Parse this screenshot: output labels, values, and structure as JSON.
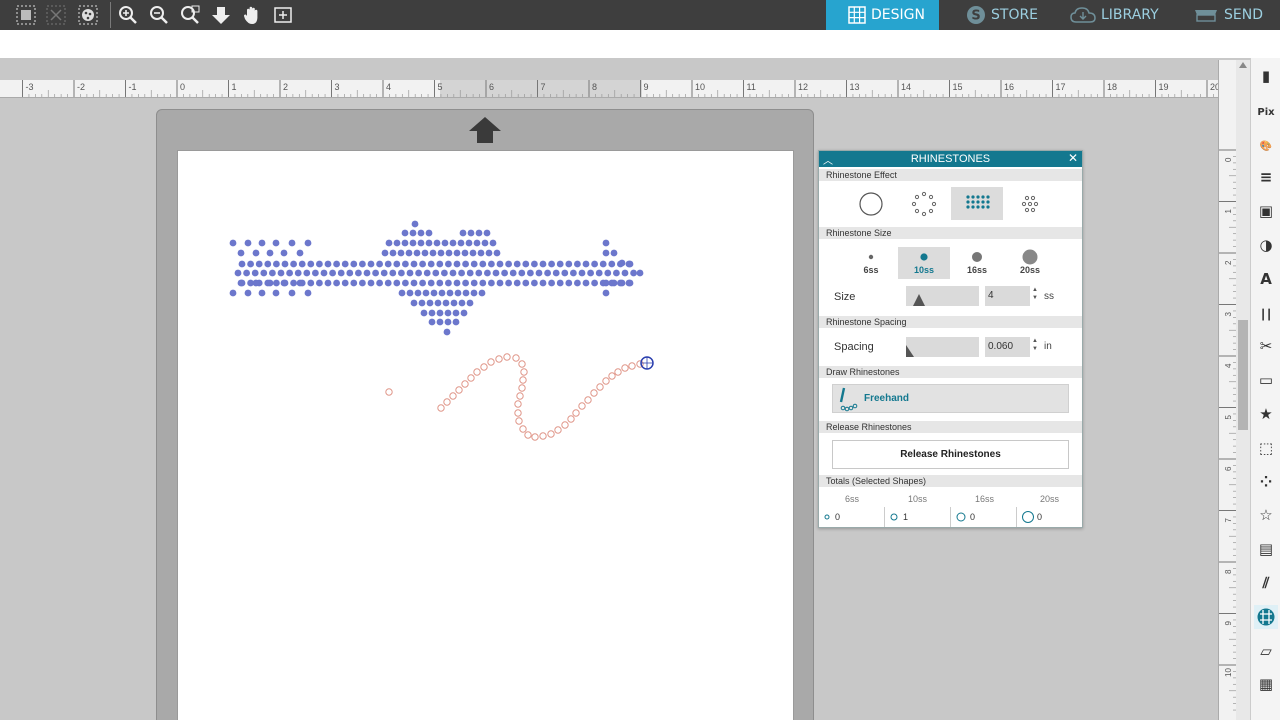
{
  "nav": {
    "tabs": [
      {
        "label": "DESIGN",
        "icon": "grid-icon",
        "active": true
      },
      {
        "label": "STORE",
        "icon": "store-s-icon",
        "active": false
      },
      {
        "label": "LIBRARY",
        "icon": "cloud-library-icon",
        "active": false
      },
      {
        "label": "SEND",
        "icon": "cutter-send-icon",
        "active": false
      }
    ]
  },
  "toolbar": {
    "icons": [
      "group-select-icon",
      "ungroup-icon",
      "fill-icon",
      "zoom-in-icon",
      "zoom-out-icon",
      "zoom-selection-icon",
      "fit-to-window-icon",
      "pan-hand-icon",
      "add-page-icon"
    ]
  },
  "ruler": {
    "h_labels": [
      "-3",
      "-2",
      "-1",
      "0",
      "1",
      "2",
      "3",
      "4",
      "5",
      "6",
      "7",
      "8",
      "9",
      "10",
      "11",
      "12",
      "13",
      "14",
      "15",
      "16",
      "17",
      "18",
      "19",
      "20"
    ],
    "v_labels": [
      "0",
      "1",
      "2",
      "3",
      "4",
      "5",
      "6",
      "7",
      "8",
      "9",
      "10"
    ]
  },
  "panel": {
    "title": "RHINESTONES",
    "sections": {
      "effect": "Rhinestone Effect",
      "size": "Rhinestone Size",
      "spacing": "Rhinestone Spacing",
      "draw": "Draw Rhinestones",
      "release": "Release Rhinestones",
      "totals": "Totals (Selected Shapes)"
    },
    "effects": [
      "single-outline-icon",
      "ring-outline-icon",
      "fill-grid-icon",
      "scatter-icon"
    ],
    "selected_effect": 2,
    "sizes": [
      "6ss",
      "10ss",
      "16ss",
      "20ss"
    ],
    "selected_size": "10ss",
    "size_label": "Size",
    "size_value": "4",
    "size_unit": "ss",
    "spacing_label": "Spacing",
    "spacing_value": "0.060",
    "spacing_unit": "in",
    "freehand_label": "Freehand",
    "release_button": "Release Rhinestones",
    "totals": {
      "headers": [
        "6ss",
        "10ss",
        "16ss",
        "20ss"
      ],
      "values": [
        "0",
        "1",
        "0",
        "0"
      ]
    }
  },
  "colors": {
    "accent": "#27a4cf",
    "panel_title": "#13788f",
    "rhinestone_fill": "#6c77cc",
    "freehand_outline": "#e0978a"
  },
  "right_tools": [
    "page-setup-icon",
    "pixscan-icon",
    "fill-palette-icon",
    "line-style-icon",
    "trace-icon",
    "transparency-icon",
    "text-style-icon",
    "align-icon",
    "knife-icon",
    "replicate-icon",
    "favorites-star-icon",
    "offset-icon",
    "rhinestone-icon",
    "library-star-icon",
    "layers-icon",
    "sketch-icon",
    "rhinestone-active-icon",
    "send-to-icon",
    "page-grid-icon"
  ]
}
